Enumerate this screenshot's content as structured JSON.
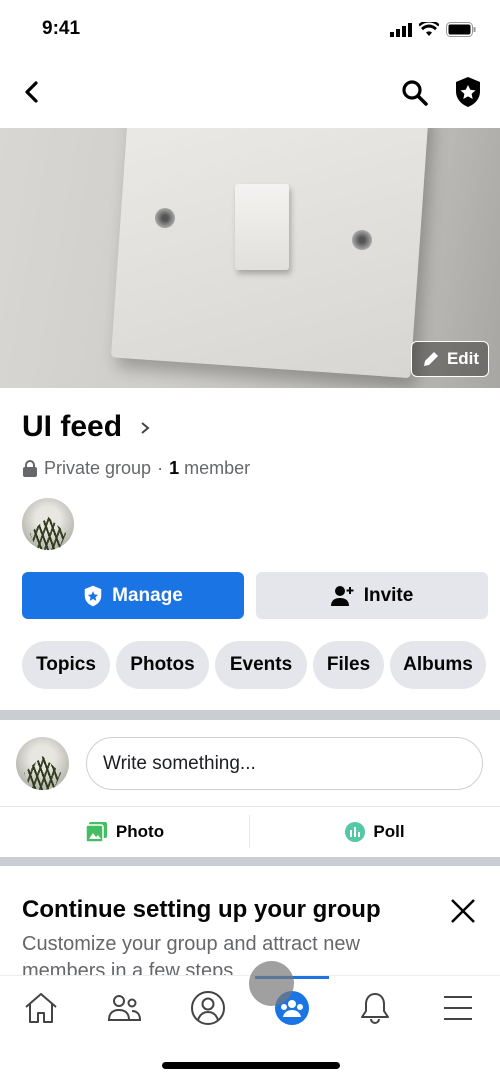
{
  "status_bar": {
    "time": "9:41"
  },
  "nav": {
    "back": "back-icon",
    "search": "search-icon",
    "admin": "shield-star-icon"
  },
  "cover": {
    "edit_label": "Edit"
  },
  "group": {
    "name": "UI feed",
    "privacy": "Private group",
    "separator": "·",
    "member_count": "1",
    "member_label": "member"
  },
  "actions": {
    "manage_label": "Manage",
    "invite_label": "Invite"
  },
  "chips": [
    {
      "label": "Topics"
    },
    {
      "label": "Photos"
    },
    {
      "label": "Events"
    },
    {
      "label": "Files"
    },
    {
      "label": "Albums"
    }
  ],
  "composer": {
    "placeholder": "Write something...",
    "photo_label": "Photo",
    "poll_label": "Poll"
  },
  "setup_card": {
    "title": "Continue setting up your group",
    "subtitle": "Customize your group and attract new members in a few steps"
  },
  "tabbar": {
    "items": [
      "home",
      "friends",
      "profile",
      "groups",
      "notifications",
      "menu"
    ],
    "active": "groups"
  },
  "colors": {
    "accent": "#1b74e4",
    "chip_bg": "#e4e6eb",
    "photo_green": "#45bd62",
    "poll_teal": "#54c7a5"
  }
}
